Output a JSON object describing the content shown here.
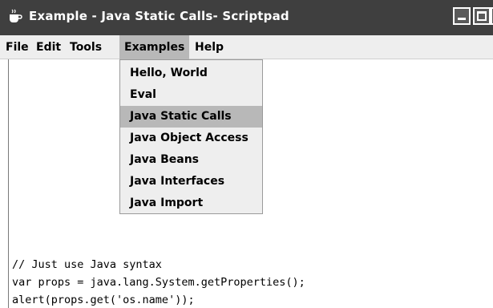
{
  "window": {
    "title": "Example - Java Static Calls- Scriptpad",
    "icons": {
      "app": "java-cup-icon",
      "minimize": "minimize-icon",
      "maximize": "maximize-icon",
      "close": "close-icon"
    }
  },
  "menubar": {
    "items": [
      {
        "label": "File"
      },
      {
        "label": "Edit"
      },
      {
        "label": "Tools"
      },
      {
        "label": "Examples",
        "active": true
      },
      {
        "label": "Help"
      }
    ]
  },
  "examples_menu": {
    "items": [
      {
        "label": "Hello, World"
      },
      {
        "label": "Eval"
      },
      {
        "label": "Java Static Calls",
        "selected": true
      },
      {
        "label": "Java Object Access"
      },
      {
        "label": "Java Beans"
      },
      {
        "label": "Java Interfaces"
      },
      {
        "label": "Java Import"
      }
    ]
  },
  "editor": {
    "lines": [
      "// Just use Java syntax",
      "var props = java.lang.System.getProperties();",
      "alert(props.get('os.name'));"
    ]
  }
}
